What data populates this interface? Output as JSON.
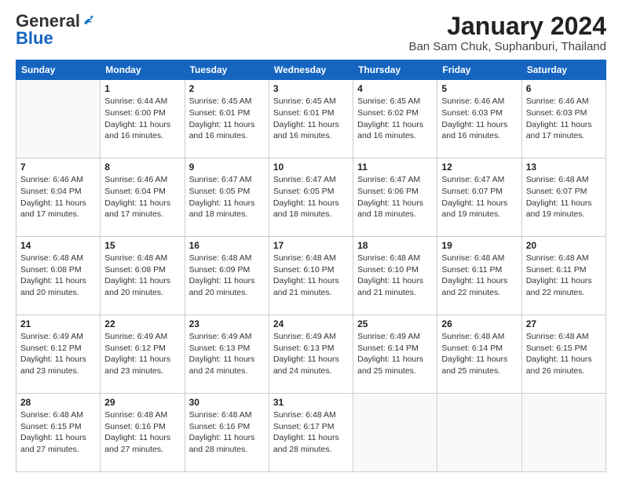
{
  "logo": {
    "general": "General",
    "blue": "Blue"
  },
  "title": "January 2024",
  "subtitle": "Ban Sam Chuk, Suphanburi, Thailand",
  "days_of_week": [
    "Sunday",
    "Monday",
    "Tuesday",
    "Wednesday",
    "Thursday",
    "Friday",
    "Saturday"
  ],
  "weeks": [
    [
      {
        "day": "",
        "info": ""
      },
      {
        "day": "1",
        "info": "Sunrise: 6:44 AM\nSunset: 6:00 PM\nDaylight: 11 hours\nand 16 minutes."
      },
      {
        "day": "2",
        "info": "Sunrise: 6:45 AM\nSunset: 6:01 PM\nDaylight: 11 hours\nand 16 minutes."
      },
      {
        "day": "3",
        "info": "Sunrise: 6:45 AM\nSunset: 6:01 PM\nDaylight: 11 hours\nand 16 minutes."
      },
      {
        "day": "4",
        "info": "Sunrise: 6:45 AM\nSunset: 6:02 PM\nDaylight: 11 hours\nand 16 minutes."
      },
      {
        "day": "5",
        "info": "Sunrise: 6:46 AM\nSunset: 6:03 PM\nDaylight: 11 hours\nand 16 minutes."
      },
      {
        "day": "6",
        "info": "Sunrise: 6:46 AM\nSunset: 6:03 PM\nDaylight: 11 hours\nand 17 minutes."
      }
    ],
    [
      {
        "day": "7",
        "info": "Sunrise: 6:46 AM\nSunset: 6:04 PM\nDaylight: 11 hours\nand 17 minutes."
      },
      {
        "day": "8",
        "info": "Sunrise: 6:46 AM\nSunset: 6:04 PM\nDaylight: 11 hours\nand 17 minutes."
      },
      {
        "day": "9",
        "info": "Sunrise: 6:47 AM\nSunset: 6:05 PM\nDaylight: 11 hours\nand 18 minutes."
      },
      {
        "day": "10",
        "info": "Sunrise: 6:47 AM\nSunset: 6:05 PM\nDaylight: 11 hours\nand 18 minutes."
      },
      {
        "day": "11",
        "info": "Sunrise: 6:47 AM\nSunset: 6:06 PM\nDaylight: 11 hours\nand 18 minutes."
      },
      {
        "day": "12",
        "info": "Sunrise: 6:47 AM\nSunset: 6:07 PM\nDaylight: 11 hours\nand 19 minutes."
      },
      {
        "day": "13",
        "info": "Sunrise: 6:48 AM\nSunset: 6:07 PM\nDaylight: 11 hours\nand 19 minutes."
      }
    ],
    [
      {
        "day": "14",
        "info": "Sunrise: 6:48 AM\nSunset: 6:08 PM\nDaylight: 11 hours\nand 20 minutes."
      },
      {
        "day": "15",
        "info": "Sunrise: 6:48 AM\nSunset: 6:08 PM\nDaylight: 11 hours\nand 20 minutes."
      },
      {
        "day": "16",
        "info": "Sunrise: 6:48 AM\nSunset: 6:09 PM\nDaylight: 11 hours\nand 20 minutes."
      },
      {
        "day": "17",
        "info": "Sunrise: 6:48 AM\nSunset: 6:10 PM\nDaylight: 11 hours\nand 21 minutes."
      },
      {
        "day": "18",
        "info": "Sunrise: 6:48 AM\nSunset: 6:10 PM\nDaylight: 11 hours\nand 21 minutes."
      },
      {
        "day": "19",
        "info": "Sunrise: 6:48 AM\nSunset: 6:11 PM\nDaylight: 11 hours\nand 22 minutes."
      },
      {
        "day": "20",
        "info": "Sunrise: 6:48 AM\nSunset: 6:11 PM\nDaylight: 11 hours\nand 22 minutes."
      }
    ],
    [
      {
        "day": "21",
        "info": "Sunrise: 6:49 AM\nSunset: 6:12 PM\nDaylight: 11 hours\nand 23 minutes."
      },
      {
        "day": "22",
        "info": "Sunrise: 6:49 AM\nSunset: 6:12 PM\nDaylight: 11 hours\nand 23 minutes."
      },
      {
        "day": "23",
        "info": "Sunrise: 6:49 AM\nSunset: 6:13 PM\nDaylight: 11 hours\nand 24 minutes."
      },
      {
        "day": "24",
        "info": "Sunrise: 6:49 AM\nSunset: 6:13 PM\nDaylight: 11 hours\nand 24 minutes."
      },
      {
        "day": "25",
        "info": "Sunrise: 6:49 AM\nSunset: 6:14 PM\nDaylight: 11 hours\nand 25 minutes."
      },
      {
        "day": "26",
        "info": "Sunrise: 6:48 AM\nSunset: 6:14 PM\nDaylight: 11 hours\nand 25 minutes."
      },
      {
        "day": "27",
        "info": "Sunrise: 6:48 AM\nSunset: 6:15 PM\nDaylight: 11 hours\nand 26 minutes."
      }
    ],
    [
      {
        "day": "28",
        "info": "Sunrise: 6:48 AM\nSunset: 6:15 PM\nDaylight: 11 hours\nand 27 minutes."
      },
      {
        "day": "29",
        "info": "Sunrise: 6:48 AM\nSunset: 6:16 PM\nDaylight: 11 hours\nand 27 minutes."
      },
      {
        "day": "30",
        "info": "Sunrise: 6:48 AM\nSunset: 6:16 PM\nDaylight: 11 hours\nand 28 minutes."
      },
      {
        "day": "31",
        "info": "Sunrise: 6:48 AM\nSunset: 6:17 PM\nDaylight: 11 hours\nand 28 minutes."
      },
      {
        "day": "",
        "info": ""
      },
      {
        "day": "",
        "info": ""
      },
      {
        "day": "",
        "info": ""
      }
    ]
  ]
}
